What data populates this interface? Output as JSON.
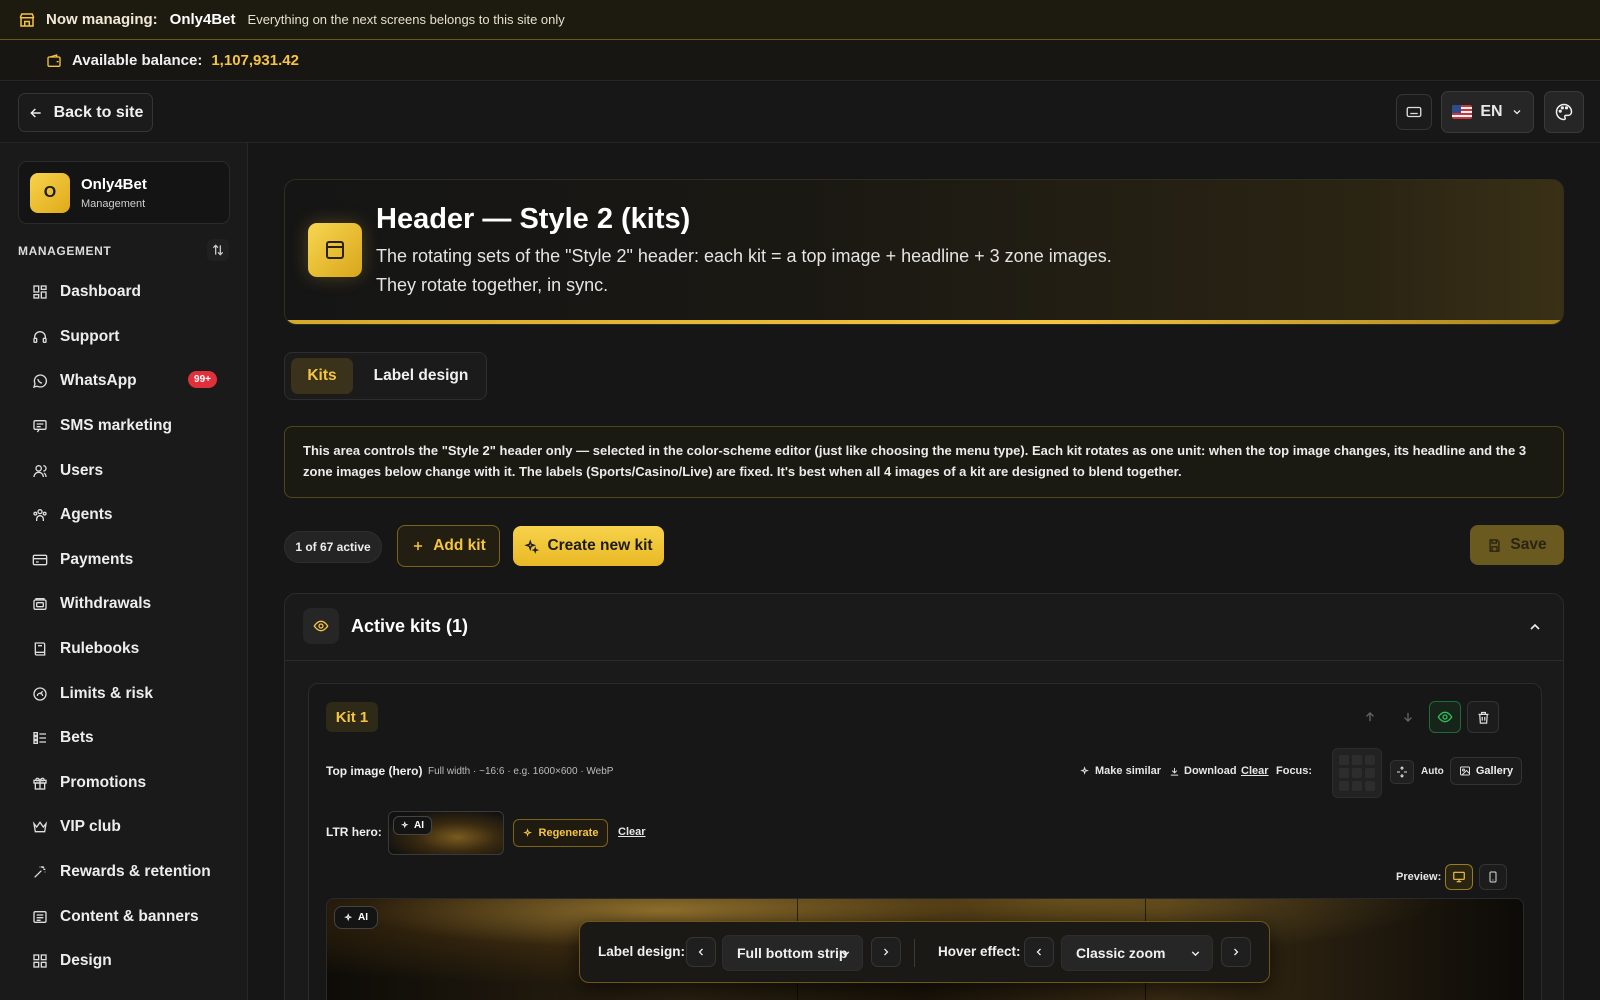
{
  "context_bar": {
    "label": "Now managing:",
    "site": "Only4Bet",
    "note": "Everything on the next screens belongs to this site only"
  },
  "balance_bar": {
    "label": "Available balance:",
    "value": "1,107,931.42"
  },
  "nav": {
    "back_label": "Back to site",
    "language": "EN"
  },
  "sidebar": {
    "brand_initial": "O",
    "brand_name": "Only4Bet",
    "brand_sub": "Management",
    "section_title": "MANAGEMENT",
    "items": [
      {
        "label": "Dashboard",
        "icon": "dashboard-icon"
      },
      {
        "label": "Support",
        "icon": "headset-icon"
      },
      {
        "label": "WhatsApp",
        "icon": "whatsapp-icon",
        "badge": "99+"
      },
      {
        "label": "SMS marketing",
        "icon": "message-icon"
      },
      {
        "label": "Users",
        "icon": "users-icon"
      },
      {
        "label": "Agents",
        "icon": "agents-icon"
      },
      {
        "label": "Payments",
        "icon": "card-icon"
      },
      {
        "label": "Withdrawals",
        "icon": "wallet-icon"
      },
      {
        "label": "Rulebooks",
        "icon": "book-icon"
      },
      {
        "label": "Limits & risk",
        "icon": "gauge-icon"
      },
      {
        "label": "Bets",
        "icon": "list-icon"
      },
      {
        "label": "Promotions",
        "icon": "gift-icon"
      },
      {
        "label": "VIP club",
        "icon": "crown-icon"
      },
      {
        "label": "Rewards & retention",
        "icon": "sparkle-icon"
      },
      {
        "label": "Content & banners",
        "icon": "content-icon"
      },
      {
        "label": "Design",
        "icon": "grid-icon"
      }
    ]
  },
  "page": {
    "title": "Header — Style 2 (kits)",
    "description_line1": "The rotating sets of the \"Style 2\" header: each kit = a top image + headline + 3 zone images.",
    "description_line2": "They rotate together, in sync.",
    "tabs": [
      {
        "label": "Kits",
        "active": true
      },
      {
        "label": "Label design",
        "active": false
      }
    ],
    "info": "This area controls the \"Style 2\" header only — selected in the color-scheme editor (just like choosing the menu type). Each kit rotates as one unit: when the top image changes, its headline and the 3 zone images below change with it. The labels (Sports/Casino/Live) are fixed. It's best when all 4 images of a kit are designed to blend together.",
    "active_count": "1 of 67 active",
    "add_kit_label": "Add kit",
    "create_kit_label": "Create new kit",
    "save_label": "Save"
  },
  "active_panel": {
    "title": "Active kits (1)",
    "kit": {
      "label": "Kit 1",
      "top_image_label": "Top image (hero)",
      "top_image_hint": "Full width · ~16:6 · e.g. 1600×600 · WebP",
      "make_similar": "Make similar",
      "download": "Download",
      "clear": "Clear",
      "focus": "Focus:",
      "auto": "Auto",
      "gallery": "Gallery",
      "ltr_label": "LTR hero:",
      "ai": "AI",
      "regenerate": "Regenerate",
      "ltr_clear": "Clear",
      "preview": "Preview:"
    }
  },
  "floating_bar": {
    "label_design": "Label design:",
    "label_design_value": "Full bottom strip",
    "hover_effect": "Hover effect:",
    "hover_effect_value": "Classic zoom"
  },
  "colors": {
    "accent": "#f5c542",
    "badge": "#e0303b",
    "success": "#2fbf5f"
  }
}
